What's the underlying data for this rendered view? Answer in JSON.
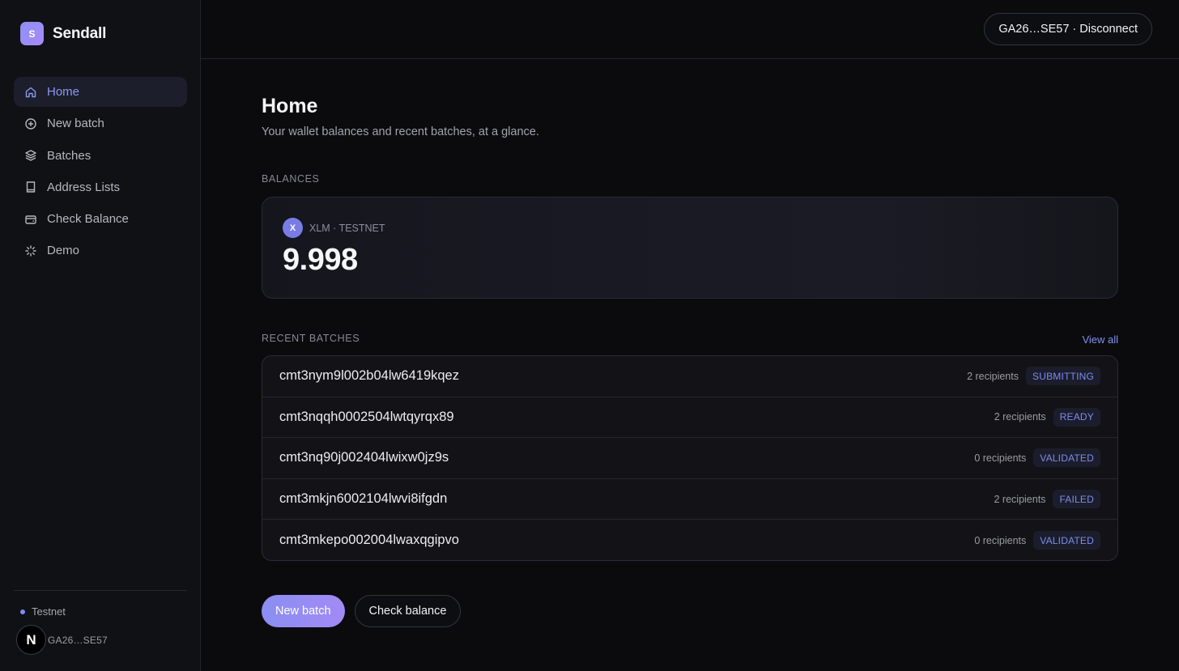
{
  "brand": {
    "logo_letter": "S",
    "name": "Sendall"
  },
  "sidebar": {
    "items": [
      {
        "label": "Home",
        "icon": "home-icon",
        "active": true
      },
      {
        "label": "New batch",
        "icon": "plus-circle-icon"
      },
      {
        "label": "Batches",
        "icon": "layers-icon"
      },
      {
        "label": "Address Lists",
        "icon": "book-icon"
      },
      {
        "label": "Check Balance",
        "icon": "wallet-icon"
      },
      {
        "label": "Demo",
        "icon": "loader-icon"
      }
    ],
    "network": "Testnet",
    "avatar_letter": "N",
    "account": "GA26…SE57"
  },
  "header": {
    "wallet_button": "GA26…SE57 · Disconnect"
  },
  "page": {
    "title": "Home",
    "subtitle": "Your wallet balances and recent batches, at a glance."
  },
  "balances": {
    "label": "BALANCES",
    "asset_icon_letter": "X",
    "asset": "XLM · TESTNET",
    "amount": "9.998"
  },
  "recent": {
    "label": "RECENT BATCHES",
    "view_all": "View all",
    "rows": [
      {
        "id": "cmt3nym9l002b04lw6419kqez",
        "recipients": "2 recipients",
        "status": "SUBMITTING"
      },
      {
        "id": "cmt3nqqh0002504lwtqyrqx89",
        "recipients": "2 recipients",
        "status": "READY"
      },
      {
        "id": "cmt3nq90j002404lwixw0jz9s",
        "recipients": "0 recipients",
        "status": "VALIDATED"
      },
      {
        "id": "cmt3mkjn6002104lwvi8ifgdn",
        "recipients": "2 recipients",
        "status": "FAILED"
      },
      {
        "id": "cmt3mkepo002004lwaxqgipvo",
        "recipients": "0 recipients",
        "status": "VALIDATED"
      }
    ]
  },
  "actions": {
    "primary": "New batch",
    "secondary": "Check balance"
  },
  "colors": {
    "accent": "#8b97f4",
    "background": "#0b0b0d",
    "sidebar": "#101114"
  }
}
